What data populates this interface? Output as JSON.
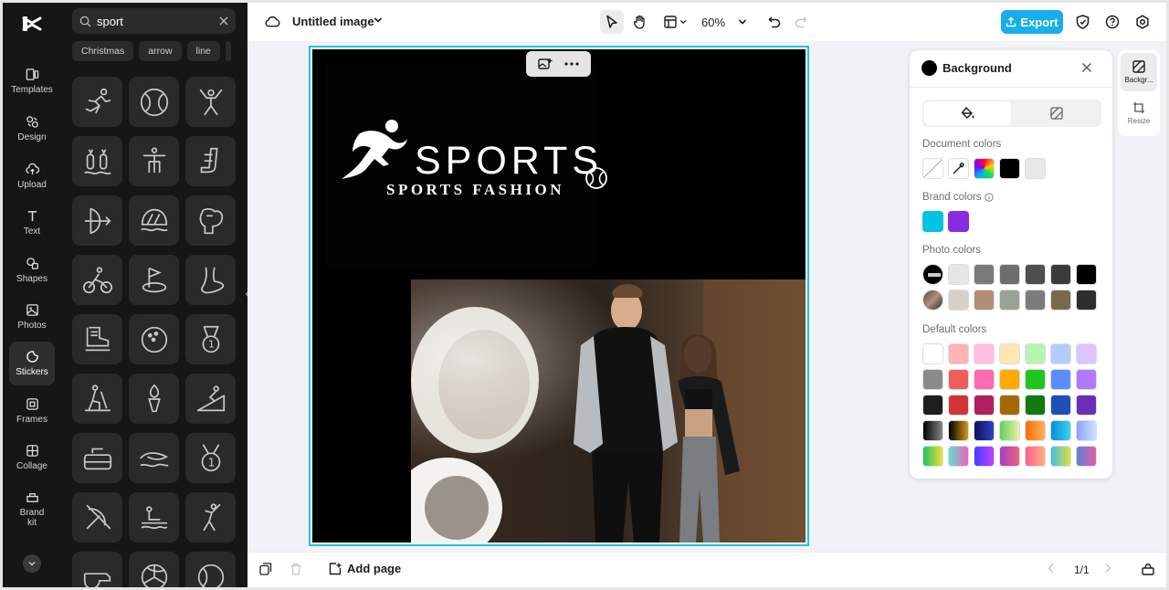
{
  "rail": {
    "items": [
      {
        "label": "Templates",
        "icon": "templates-icon"
      },
      {
        "label": "Design",
        "icon": "design-icon"
      },
      {
        "label": "Upload",
        "icon": "upload-icon"
      },
      {
        "label": "Text",
        "icon": "text-icon"
      },
      {
        "label": "Shapes",
        "icon": "shapes-icon"
      },
      {
        "label": "Photos",
        "icon": "photos-icon"
      },
      {
        "label": "Stickers",
        "icon": "stickers-icon"
      },
      {
        "label": "Frames",
        "icon": "frames-icon"
      },
      {
        "label": "Collage",
        "icon": "collage-icon"
      },
      {
        "label": "Brand kit",
        "icon": "brand-kit-icon"
      }
    ],
    "active": "Stickers"
  },
  "stickers": {
    "search_value": "sport",
    "chips": [
      "Christmas",
      "arrow",
      "line"
    ],
    "sticker_icons": [
      "runner-sticker",
      "tennis-ball-sticker",
      "gymnast-sticker",
      "swimming-sticker",
      "high-jump-sticker",
      "hockey-stick-sticker",
      "archery-sticker",
      "swimming-cap-sticker",
      "boxing-glove-sticker",
      "cycling-sticker",
      "golf-sticker",
      "foot-sticker",
      "ice-skate-sticker",
      "bowling-ball-sticker",
      "medal-sticker",
      "skiing-sticker",
      "torch-sticker",
      "ski-slope-sticker",
      "curling-stone-sticker",
      "surfing-sticker",
      "medal-one-sticker",
      "no-archery-sticker",
      "diving-sticker",
      "athlete-sticker",
      "whistle-sticker",
      "volleyball-sticker",
      "tennis-sticker"
    ]
  },
  "topbar": {
    "title": "Untitled image",
    "zoom": "60%",
    "export_label": "Export"
  },
  "artboard": {
    "brand_big": "SPORTS",
    "brand_small": "SPORTS FASHION"
  },
  "background_panel": {
    "title": "Background",
    "sections": {
      "document": "Document colors",
      "brand": "Brand colors",
      "photo": "Photo colors",
      "default": "Default colors"
    },
    "document_colors": [
      "#000000",
      "#e8e8e8"
    ],
    "brand_colors": [
      "#00c4e0",
      "#8a2be2"
    ],
    "photo_colors_row1": [
      "#e6e6e6",
      "#7a7a7a",
      "#6e6e6e",
      "#4f4f4f",
      "#3b3b3b",
      "#000000"
    ],
    "photo_colors_row2": [
      "#d6d0ca",
      "#b08f75",
      "#9aa296",
      "#7c7c7c",
      "#7a6a4c",
      "#2e2e2e"
    ],
    "default_colors": [
      [
        "#ffffff",
        "#ffb3b3",
        "#ffbde0",
        "#ffe7b3",
        "#b5f5b1",
        "#b3ccff",
        "#dcc4ff"
      ],
      [
        "#8a8a8a",
        "#f25c5c",
        "#ff6bb0",
        "#ffaa00",
        "#22c41e",
        "#5c8dff",
        "#b07aff"
      ],
      [
        "#1e1e1e",
        "#d13434",
        "#b02060",
        "#a06a00",
        "#0f7a10",
        "#1f4fb8",
        "#6a2fb8"
      ],
      [
        "linear-gradient(90deg,#000,#888)",
        "linear-gradient(90deg,#000,#d09a20)",
        "linear-gradient(90deg,#101060,#3040c0)",
        "linear-gradient(90deg,#60d060,#f0f0a0)",
        "linear-gradient(90deg,#ff6a00,#ffb060)",
        "linear-gradient(90deg,#0090e0,#40d0f0)",
        "linear-gradient(90deg,#90a0ff,#d0e0ff)"
      ],
      [
        "linear-gradient(90deg,#20c060,#f0e040)",
        "linear-gradient(90deg,#60e0d0,#f060c0)",
        "linear-gradient(90deg,#4040ff,#c040ff)",
        "linear-gradient(90deg,#a040c0,#f06080)",
        "linear-gradient(90deg,#ff6090,#ffb080)",
        "linear-gradient(90deg,#40c0e0,#e0e040)",
        "linear-gradient(90deg,#6080e0,#e060a0)"
      ]
    ]
  },
  "right_rail": {
    "background_label": "Backgr...",
    "resize_label": "Resize"
  },
  "bottombar": {
    "add_page_label": "Add page",
    "pager": "1/1"
  },
  "colors": {
    "accent": "#19aeea",
    "selection": "#19c4e6",
    "dark_panel": "#161616"
  }
}
